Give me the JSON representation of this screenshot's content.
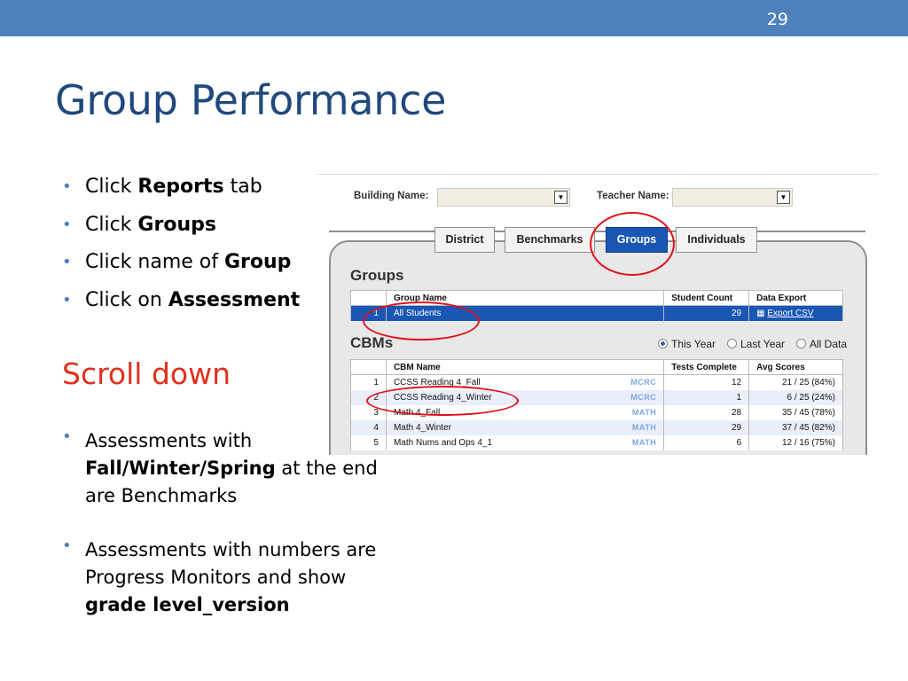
{
  "slide": {
    "number": "29",
    "title": "Group Performance",
    "scroll_note": "Scroll down"
  },
  "instructions": [
    {
      "pre": "Click ",
      "bold": "Reports",
      "post": " tab"
    },
    {
      "pre": "Click ",
      "bold": "Groups",
      "post": ""
    },
    {
      "pre": "Click name of ",
      "bold": "Group",
      "post": ""
    },
    {
      "pre": "Click on ",
      "bold": "Assessment",
      "post": ""
    }
  ],
  "notes": [
    {
      "pre": "Assessments with",
      "bold": "Fall/Winter/Spring",
      "post": " at the end",
      "tail": "are Benchmarks"
    },
    {
      "pre": "Assessments with numbers are",
      "mid": "Progress Monitors and show",
      "bold": "grade level_version"
    }
  ],
  "colors": {
    "accent": "#4f81bd",
    "title": "#1f497d",
    "scroll": "#e0301e",
    "annotation": "#e0101a",
    "selected": "#1a56b4"
  },
  "screenshot": {
    "building_label": "Building Name:",
    "teacher_label": "Teacher Name:",
    "tabs": [
      "District",
      "Benchmarks",
      "Groups",
      "Individuals"
    ],
    "active_tab": "Groups",
    "groups": {
      "title": "Groups",
      "headers": [
        "Group Name",
        "Student Count",
        "Data Export"
      ],
      "rows": [
        {
          "index": "1",
          "name": "All Students",
          "count": "29",
          "export": "Export CSV",
          "export_icon": "spreadsheet-icon"
        }
      ]
    },
    "cbms": {
      "title": "CBMs",
      "filters": [
        "This Year",
        "Last Year",
        "All Data"
      ],
      "selected_filter": "This Year",
      "headers": [
        "CBM Name",
        "Tests Complete",
        "Avg Scores"
      ],
      "rows": [
        {
          "index": "1",
          "name": "CCSS Reading 4_Fall",
          "tag": "MCRC",
          "tests": "12",
          "avg": "21 / 25 (84%)"
        },
        {
          "index": "2",
          "name": "CCSS Reading 4_Winter",
          "tag": "MCRC",
          "tests": "1",
          "avg": "6 / 25 (24%)"
        },
        {
          "index": "3",
          "name": "Math 4_Fall",
          "tag": "MATH",
          "tests": "28",
          "avg": "35 / 45 (78%)"
        },
        {
          "index": "4",
          "name": "Math 4_Winter",
          "tag": "MATH",
          "tests": "29",
          "avg": "37 / 45 (82%)"
        },
        {
          "index": "5",
          "name": "Math Nums and Ops 4_1",
          "tag": "MATH",
          "tests": "6",
          "avg": "12 / 16 (75%)"
        }
      ]
    }
  }
}
